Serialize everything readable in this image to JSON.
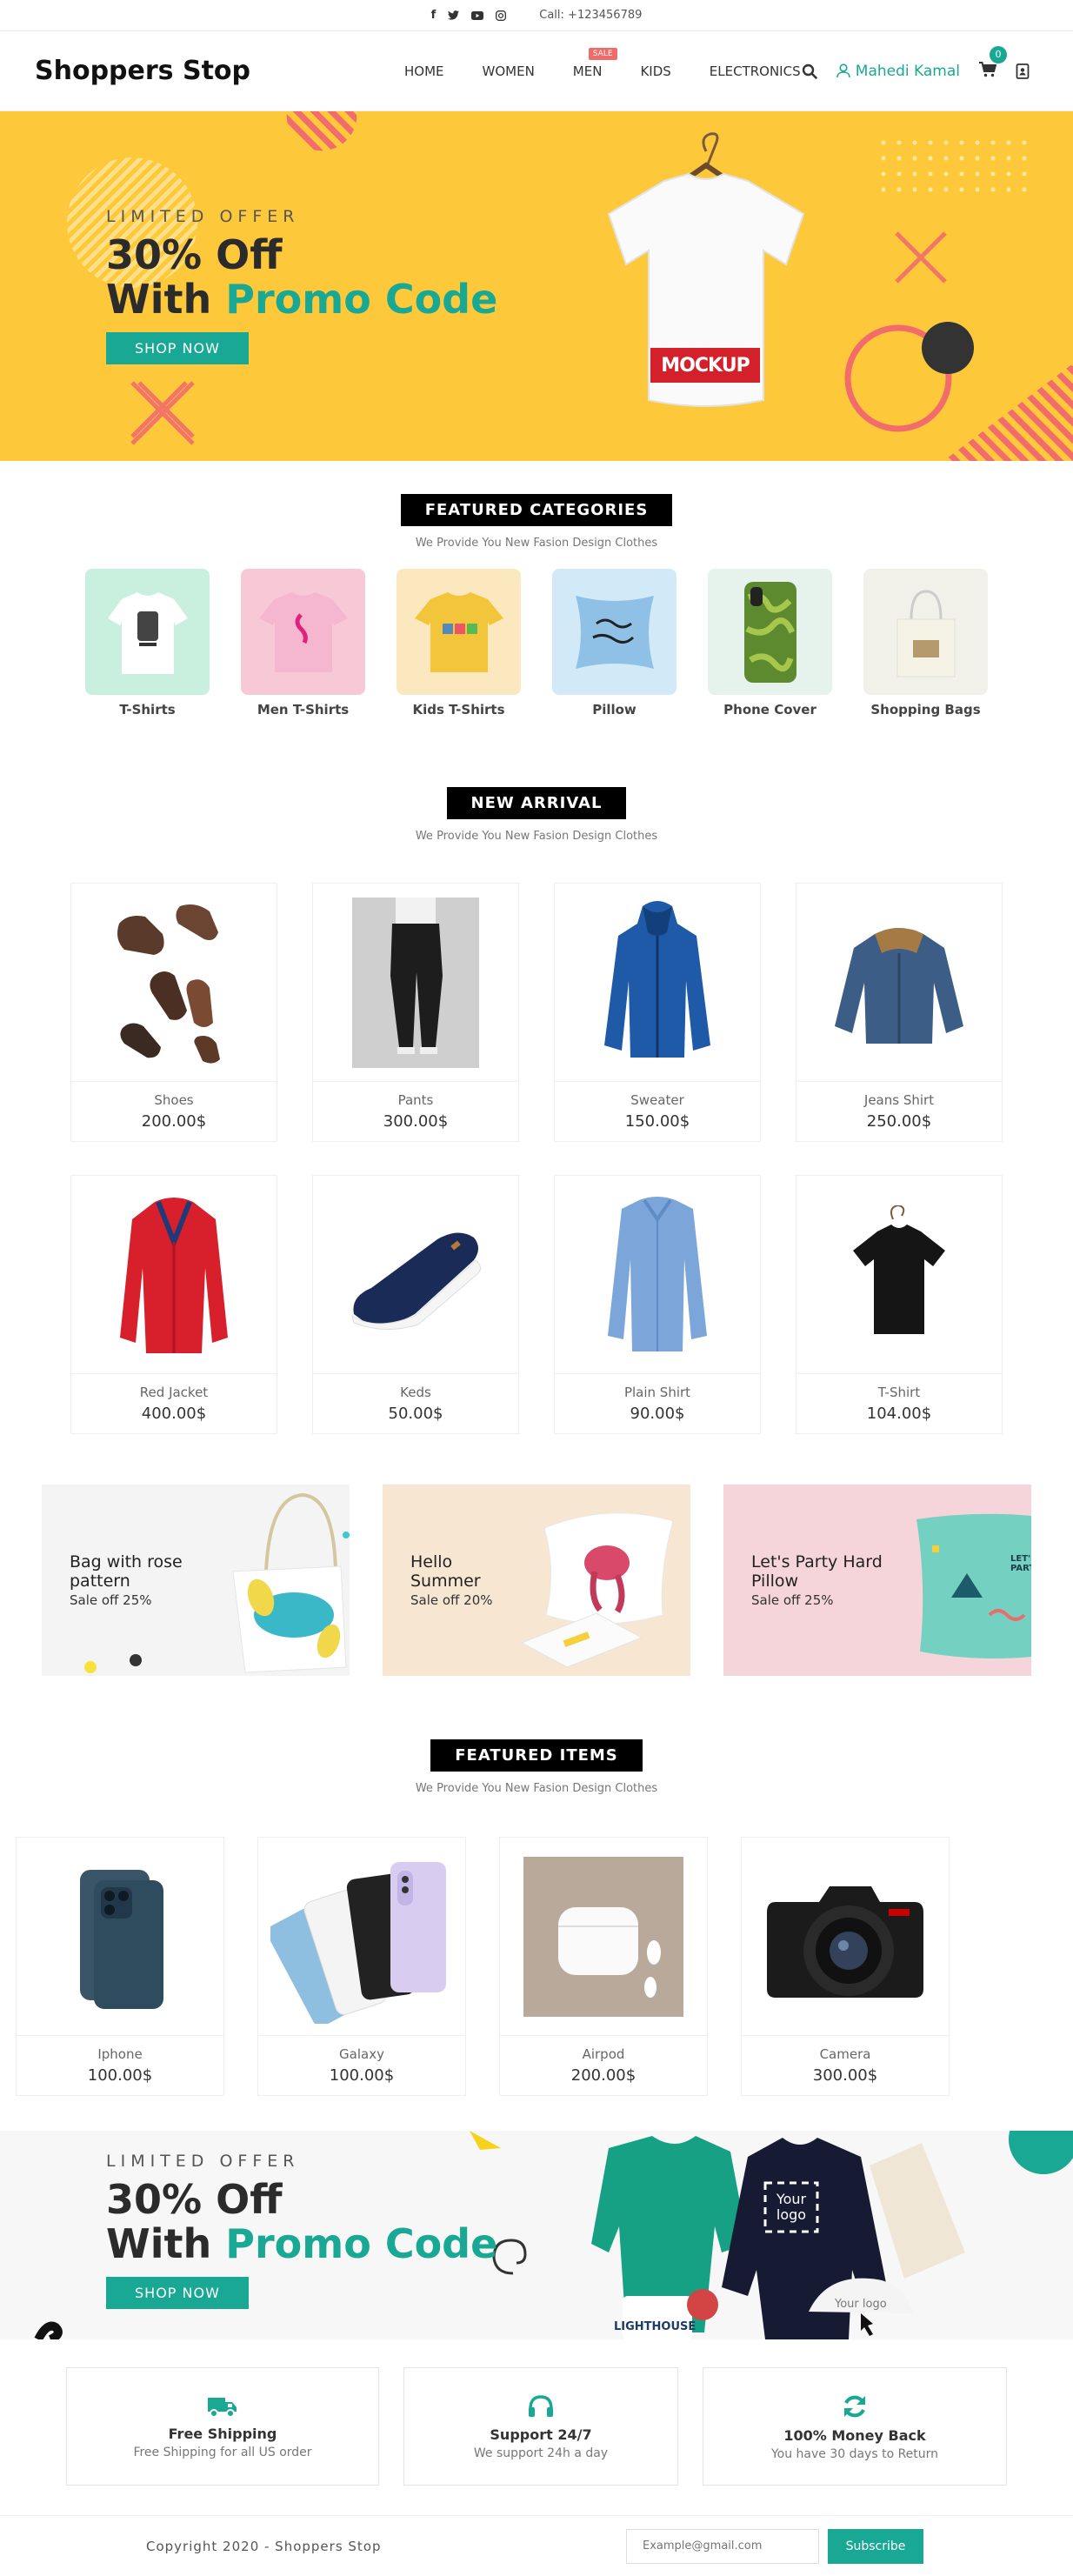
{
  "topbar": {
    "phone": "Call: +123456789",
    "social": [
      "facebook-icon",
      "twitter-icon",
      "youtube-icon",
      "instagram-icon"
    ]
  },
  "header": {
    "logo": "Shoppers Stop",
    "nav": [
      "HOME",
      "WOMEN",
      "MEN",
      "KIDS",
      "ELECTRONICS"
    ],
    "sale_badge": "SALE",
    "user": "Mahedi Kamal",
    "cart_count": "0"
  },
  "hero": {
    "kicker": "LIMITED OFFER",
    "line1": "30% Off",
    "line2a": "With ",
    "line2b": "Promo Code",
    "button": "SHOP NOW",
    "mockup": "MOCKUP"
  },
  "categories": {
    "title": "FEATURED CATEGORIES",
    "subtitle": "We Provide You New Fasion Design Clothes",
    "items": [
      "T-Shirts",
      "Men T-Shirts",
      "Kids T-Shirts",
      "Pillow",
      "Phone Cover",
      "Shopping Bags"
    ]
  },
  "arrival": {
    "title": "NEW ARRIVAL",
    "subtitle": "We Provide You New Fasion Design Clothes",
    "products": [
      {
        "name": "Shoes",
        "price": "200.00$"
      },
      {
        "name": "Pants",
        "price": "300.00$"
      },
      {
        "name": "Sweater",
        "price": "150.00$"
      },
      {
        "name": "Jeans Shirt",
        "price": "250.00$"
      },
      {
        "name": "Red Jacket",
        "price": "400.00$"
      },
      {
        "name": "Keds",
        "price": "50.00$"
      },
      {
        "name": "Plain Shirt",
        "price": "90.00$"
      },
      {
        "name": "T-Shirt",
        "price": "104.00$"
      }
    ]
  },
  "promos": [
    {
      "line1": "Bag with rose",
      "line2": "pattern",
      "sub": "Sale off 25%"
    },
    {
      "line1": "Hello",
      "line2": "Summer",
      "sub": "Sale off 20%"
    },
    {
      "line1": "Let's Party Hard",
      "line2": "Pillow",
      "sub": "Sale off 25%"
    }
  ],
  "featured": {
    "title": "FEATURED ITEMS",
    "subtitle": "We Provide You New Fasion Design Clothes",
    "products": [
      {
        "name": "Iphone",
        "price": "100.00$"
      },
      {
        "name": "Galaxy",
        "price": "100.00$"
      },
      {
        "name": "Airpod",
        "price": "200.00$"
      },
      {
        "name": "Camera",
        "price": "300.00$"
      }
    ]
  },
  "hero2": {
    "kicker": "LIMITED OFFER",
    "line1": "30% Off",
    "line2a": "With ",
    "line2b": "Promo Code",
    "button": "SHOP NOW",
    "logo_text": "Your logo",
    "cap_text": "Your logo",
    "sticker": "LIGHTHOUSE"
  },
  "services": [
    {
      "icon": "truck-icon",
      "title": "Free Shipping",
      "sub": "Free Shipping for all US order"
    },
    {
      "icon": "headset-icon",
      "title": "Support 24/7",
      "sub": "We support 24h a day"
    },
    {
      "icon": "refresh-icon",
      "title": "100% Money Back",
      "sub": "You have 30 days to Return"
    }
  ],
  "footer": {
    "copyright": "Copyright 2020 - Shoppers Stop",
    "email_placeholder": "Example@gmail.com",
    "subscribe": "Subscribe"
  }
}
